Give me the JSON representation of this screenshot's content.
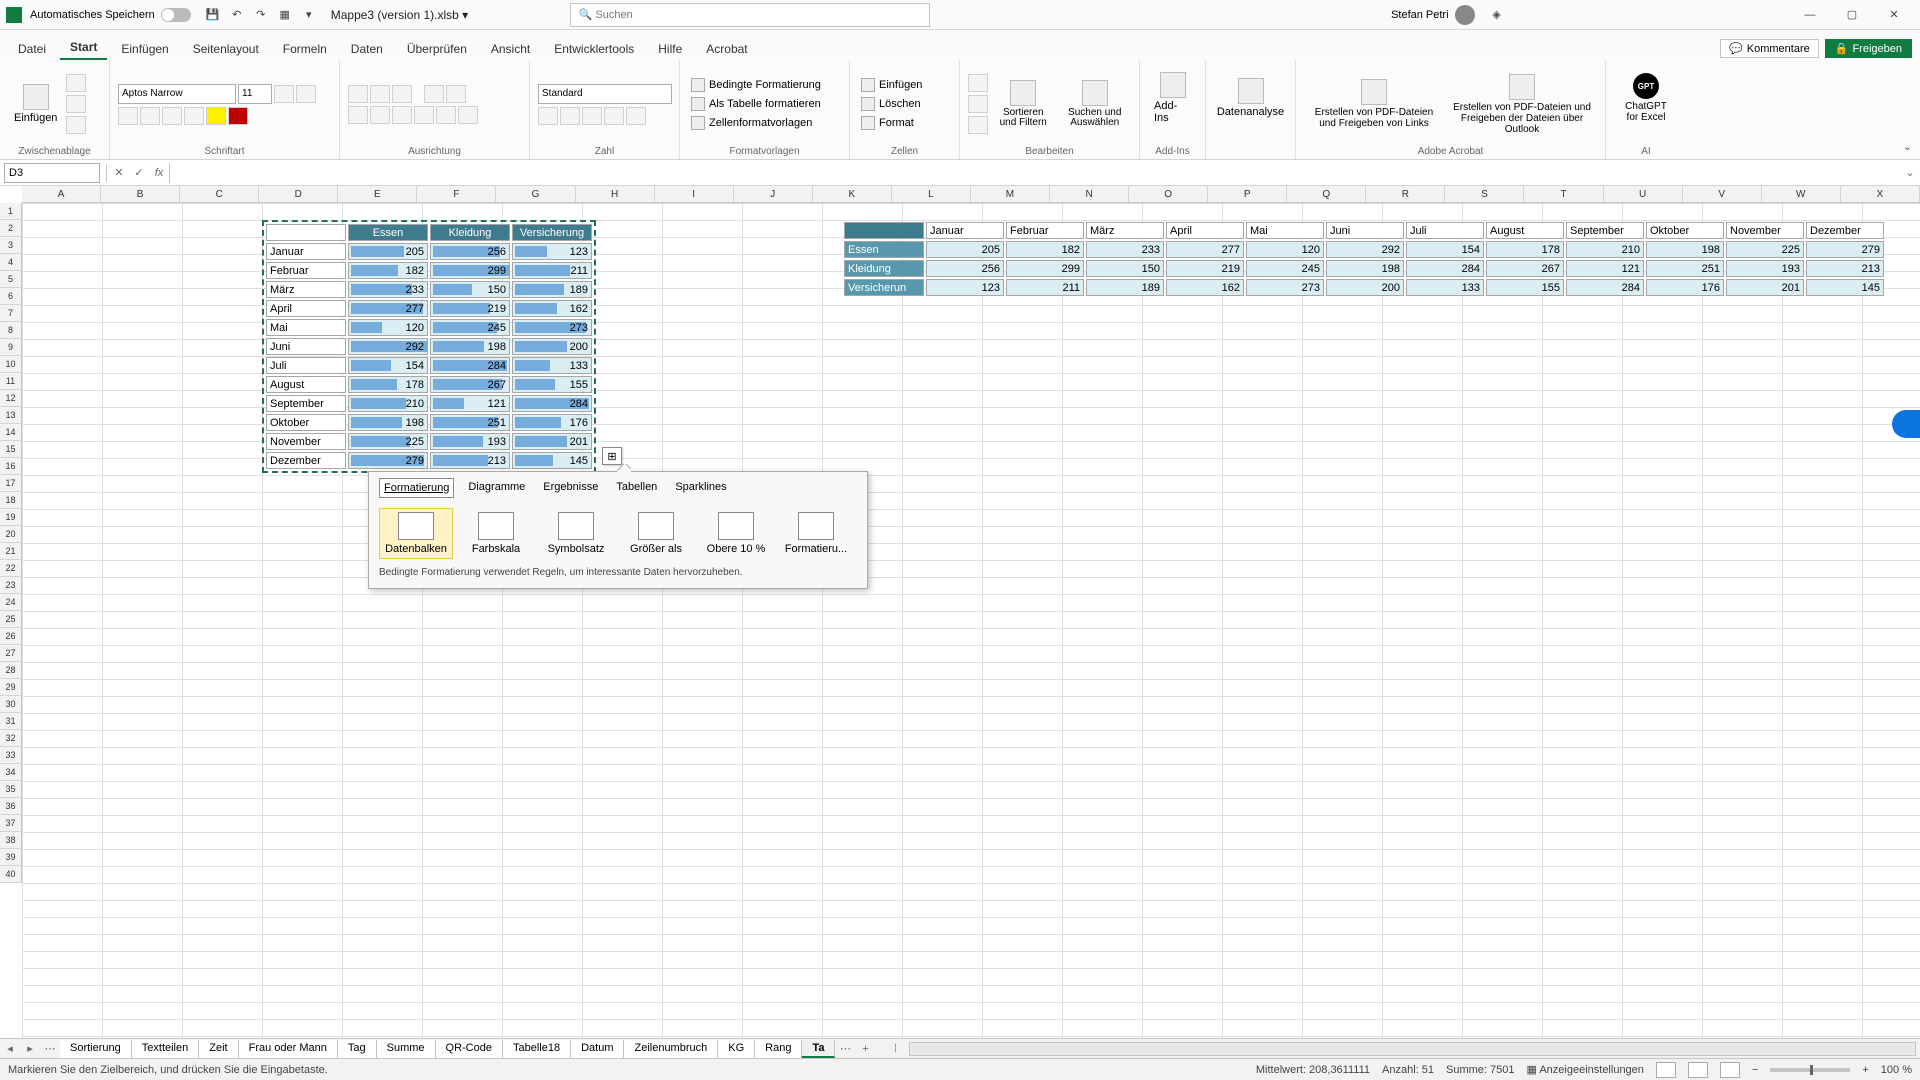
{
  "titlebar": {
    "autosave": "Automatisches Speichern",
    "filename": "Mappe3 (version 1).xlsb ▾",
    "search_placeholder": "Suchen",
    "user": "Stefan Petri"
  },
  "tabs": {
    "items": [
      "Datei",
      "Start",
      "Einfügen",
      "Seitenlayout",
      "Formeln",
      "Daten",
      "Überprüfen",
      "Ansicht",
      "Entwicklertools",
      "Hilfe",
      "Acrobat"
    ],
    "active": 1,
    "comments": "Kommentare",
    "share": "Freigeben"
  },
  "ribbon": {
    "clipboard": {
      "paste": "Einfügen",
      "label": "Zwischenablage"
    },
    "font": {
      "name": "Aptos Narrow",
      "size": "11",
      "label": "Schriftart"
    },
    "align": {
      "label": "Ausrichtung"
    },
    "number": {
      "format": "Standard",
      "label": "Zahl"
    },
    "styles": {
      "cond": "Bedingte Formatierung",
      "table": "Als Tabelle formatieren",
      "cell": "Zellenformatvorlagen",
      "label": "Formatvorlagen"
    },
    "cells": {
      "ins": "Einfügen",
      "del": "Löschen",
      "fmt": "Format",
      "label": "Zellen"
    },
    "editing": {
      "sort": "Sortieren und Filtern",
      "find": "Suchen und Auswählen",
      "label": "Bearbeiten"
    },
    "addins": {
      "btn": "Add-Ins",
      "label": "Add-Ins"
    },
    "analysis": {
      "btn": "Datenanalyse"
    },
    "acrobat": {
      "pdf1": "Erstellen von PDF-Dateien und Freigeben von Links",
      "pdf2": "Erstellen von PDF-Dateien und Freigeben der Dateien über Outlook",
      "label": "Adobe Acrobat"
    },
    "ai": {
      "btn": "ChatGPT for Excel",
      "label": "AI"
    }
  },
  "namebox": "D3",
  "cols": [
    "A",
    "B",
    "C",
    "D",
    "E",
    "F",
    "G",
    "H",
    "I",
    "J",
    "K",
    "L",
    "M",
    "N",
    "O",
    "P",
    "Q",
    "R",
    "S",
    "T",
    "U",
    "V",
    "W",
    "X"
  ],
  "table1": {
    "headers": [
      "",
      "Essen",
      "Kleidung",
      "Versicherung"
    ],
    "rows": [
      [
        "Januar",
        "205",
        "256",
        "123"
      ],
      [
        "Februar",
        "182",
        "299",
        "211"
      ],
      [
        "März",
        "233",
        "150",
        "189"
      ],
      [
        "April",
        "277",
        "219",
        "162"
      ],
      [
        "Mai",
        "120",
        "245",
        "273"
      ],
      [
        "Juni",
        "292",
        "198",
        "200"
      ],
      [
        "Juli",
        "154",
        "284",
        "133"
      ],
      [
        "August",
        "178",
        "267",
        "155"
      ],
      [
        "September",
        "210",
        "121",
        "284"
      ],
      [
        "Oktober",
        "198",
        "251",
        "176"
      ],
      [
        "November",
        "225",
        "193",
        "201"
      ],
      [
        "Dezember",
        "279",
        "213",
        "145"
      ]
    ]
  },
  "table2": {
    "headers": [
      "",
      "Januar",
      "Februar",
      "März",
      "April",
      "Mai",
      "Juni",
      "Juli",
      "August",
      "September",
      "Oktober",
      "November",
      "Dezember"
    ],
    "rows": [
      [
        "Essen",
        "205",
        "182",
        "233",
        "277",
        "120",
        "292",
        "154",
        "178",
        "210",
        "198",
        "225",
        "279"
      ],
      [
        "Kleidung",
        "256",
        "299",
        "150",
        "219",
        "245",
        "198",
        "284",
        "267",
        "121",
        "251",
        "193",
        "213"
      ],
      [
        "Versicherun",
        "123",
        "211",
        "189",
        "162",
        "273",
        "200",
        "133",
        "155",
        "284",
        "176",
        "201",
        "145"
      ]
    ]
  },
  "qa": {
    "tabs": [
      "Formatierung",
      "Diagramme",
      "Ergebnisse",
      "Tabellen",
      "Sparklines"
    ],
    "items": [
      "Datenbalken",
      "Farbskala",
      "Symbolsatz",
      "Größer als",
      "Obere 10 %",
      "Formatieru..."
    ],
    "desc": "Bedingte Formatierung verwendet Regeln, um interessante Daten hervorzuheben."
  },
  "sheets": [
    "Sortierung",
    "Textteilen",
    "Zeit",
    "Frau oder Mann",
    "Tag",
    "Summe",
    "QR-Code",
    "Tabelle18",
    "Datum",
    "Zeilenumbruch",
    "KG",
    "Rang",
    "Ta"
  ],
  "status": {
    "msg": "Markieren Sie den Zielbereich, und drücken Sie die Eingabetaste.",
    "avg": "Mittelwert: 208,3611111",
    "cnt": "Anzahl: 51",
    "sum": "Summe: 7501",
    "acc": "Anzeigeeinstellungen",
    "zoom": "100 %"
  }
}
